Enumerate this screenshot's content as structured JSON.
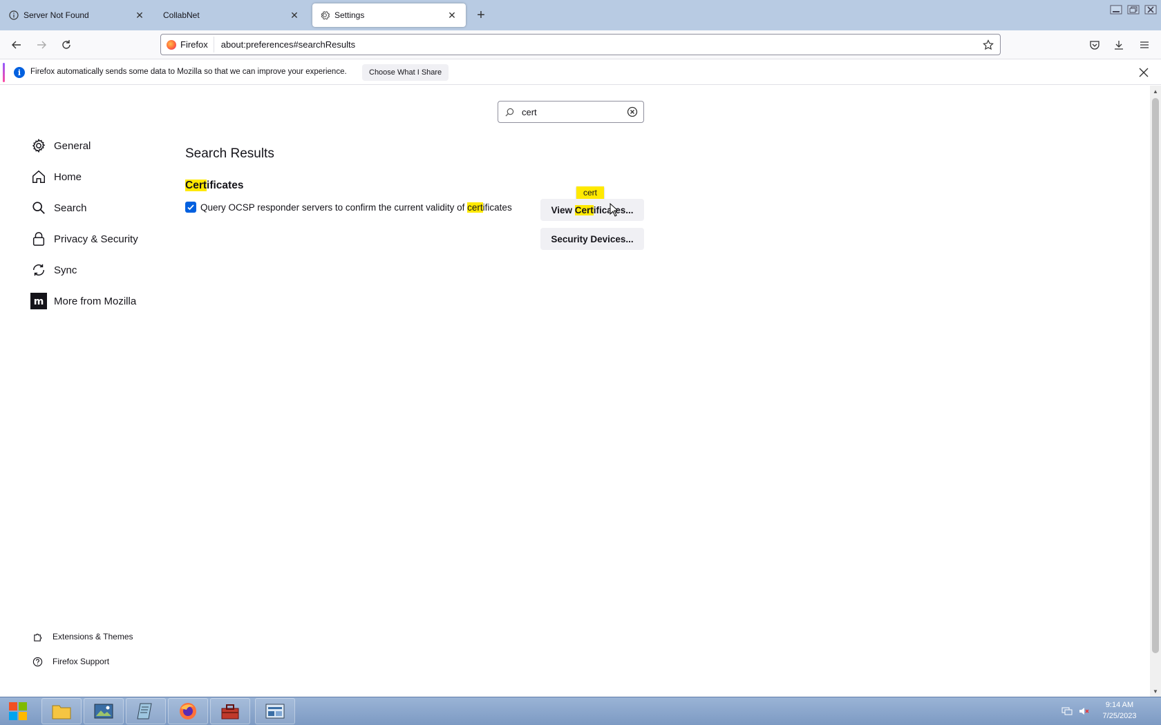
{
  "tabs": [
    {
      "label": "Server Not Found",
      "icon": "info-icon",
      "active": false
    },
    {
      "label": "CollabNet",
      "icon": "none",
      "active": false
    },
    {
      "label": "Settings",
      "icon": "gear-icon",
      "active": true
    }
  ],
  "navbar": {
    "identity_label": "Firefox",
    "url": "about:preferences#searchResults"
  },
  "notification": {
    "message": "Firefox automatically sends some data to Mozilla so that we can improve your experience.",
    "button_label": "Choose What I Share"
  },
  "search": {
    "value": "cert"
  },
  "sidebar": {
    "items": [
      {
        "label": "General",
        "icon": "gear-icon"
      },
      {
        "label": "Home",
        "icon": "home-icon"
      },
      {
        "label": "Search",
        "icon": "search-icon"
      },
      {
        "label": "Privacy & Security",
        "icon": "lock-icon"
      },
      {
        "label": "Sync",
        "icon": "sync-icon"
      },
      {
        "label": "More from Mozilla",
        "icon": "mozilla-icon"
      }
    ],
    "footer": [
      {
        "label": "Extensions & Themes",
        "icon": "puzzle-icon"
      },
      {
        "label": "Firefox Support",
        "icon": "help-icon"
      }
    ]
  },
  "results": {
    "title": "Search Results",
    "section_title_highlight": "Cert",
    "section_title_rest": "ificates",
    "checkbox": {
      "checked": true,
      "text_before": "Query OCSP responder servers to confirm the current validity of ",
      "text_highlight": "cert",
      "text_after": "ificates"
    },
    "view_button_before": "View ",
    "view_button_highlight": "Cert",
    "view_button_after": "ificates...",
    "security_button": "Security Devices...",
    "tooltip": "cert"
  },
  "taskbar": {
    "time": "9:14 AM",
    "date": "7/25/2023"
  },
  "colors": {
    "accent": "#0060df",
    "highlight": "#ffe900",
    "tabbar": "#b8cbe3"
  }
}
